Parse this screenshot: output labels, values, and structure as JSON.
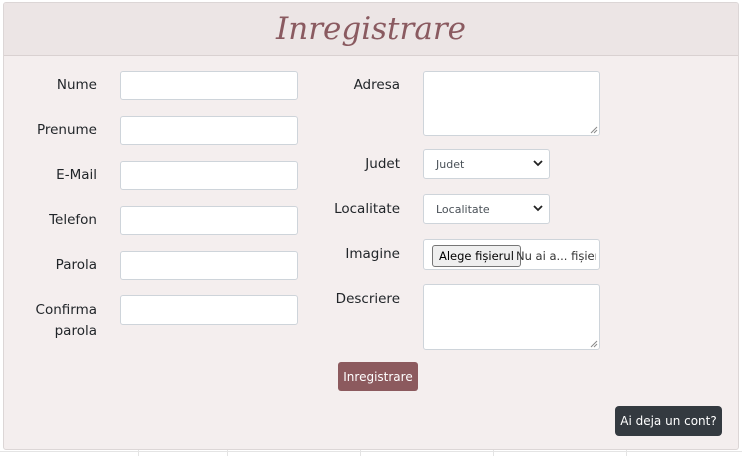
{
  "page": {
    "title": "Inregistrare"
  },
  "form": {
    "left_fields": [
      {
        "label": "Nume",
        "value": ""
      },
      {
        "label": "Prenume",
        "value": ""
      },
      {
        "label": "E-Mail",
        "value": ""
      },
      {
        "label": "Telefon",
        "value": ""
      },
      {
        "label": "Parola",
        "value": ""
      },
      {
        "label_line1": "Confirma",
        "label_line2": "parola",
        "value": ""
      }
    ],
    "adresa": {
      "label": "Adresa",
      "value": ""
    },
    "judet": {
      "label": "Judet",
      "selected": "Judet"
    },
    "localitate": {
      "label": "Localitate",
      "selected": "Localitate"
    },
    "imagine": {
      "label": "Imagine",
      "button_label": "Alege fișierul",
      "status": "Nu ai a... fișier"
    },
    "descriere": {
      "label": "Descriere",
      "value": ""
    },
    "submit_label": "Inregistrare"
  },
  "login_link": {
    "label": "Ai deja un cont?"
  },
  "colors": {
    "card_bg": "#f4eeee",
    "header_bg": "#ece5e5",
    "title": "#8a5a60",
    "submit_btn": "#8c5a5e",
    "dark_btn": "#343a40"
  }
}
